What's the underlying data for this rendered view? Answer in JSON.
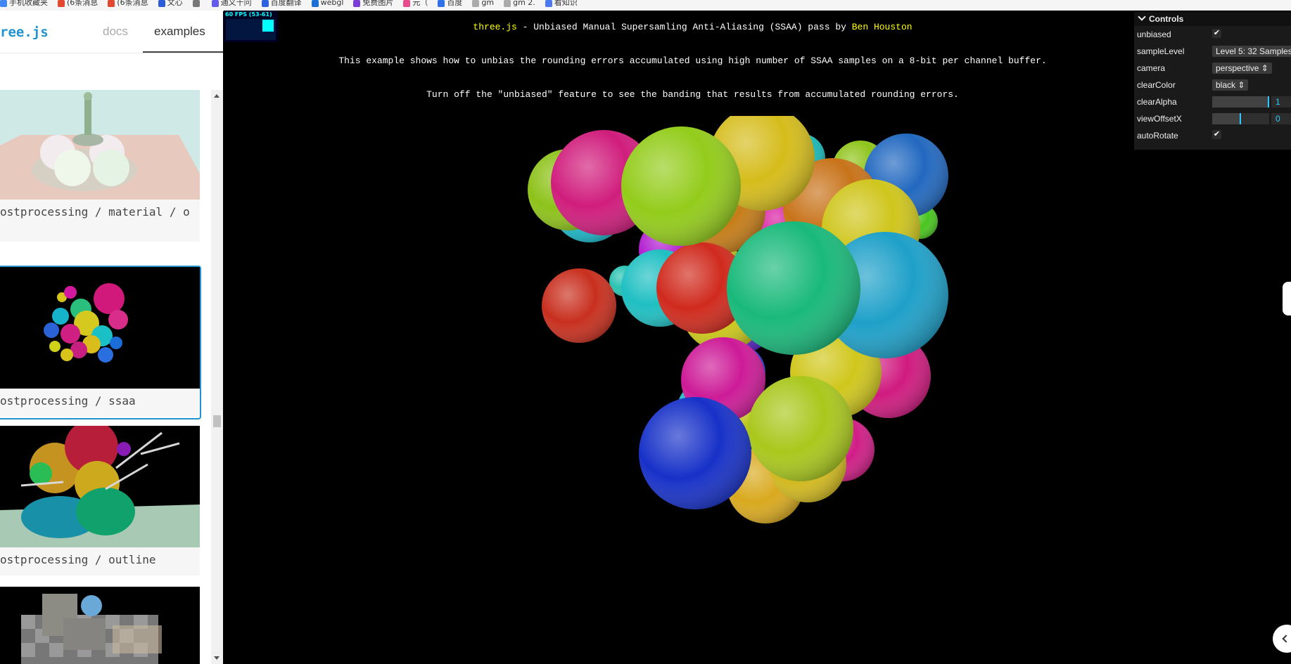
{
  "bookmarks": [
    {
      "label": "手机收藏夹",
      "color": "#4285f4"
    },
    {
      "label": "(6条消息",
      "color": "#e2472f"
    },
    {
      "label": "(6条消息",
      "color": "#e2472f"
    },
    {
      "label": "文心",
      "color": "#2b5bd7"
    },
    {
      "label": "",
      "color": "#777"
    },
    {
      "label": "通义千问",
      "color": "#615ced"
    },
    {
      "label": "百度翻译",
      "color": "#2d63e0"
    },
    {
      "label": "webgl",
      "color": "#1c6fd6"
    },
    {
      "label": "免费图片",
      "color": "#7a3ed6"
    },
    {
      "label": "元（",
      "color": "#e94b8c"
    },
    {
      "label": "百度",
      "color": "#3070e8"
    },
    {
      "label": "gm",
      "color": "#aaa"
    },
    {
      "label": "gm 2.",
      "color": "#aaa"
    },
    {
      "label": "看知识",
      "color": "#4a78f0"
    }
  ],
  "sidebar": {
    "logo": "ree.js",
    "tab_docs": "docs",
    "tab_examples": "examples",
    "cards": [
      {
        "label": "ostprocessing / material / o"
      },
      {
        "label": "ostprocessing / ssaa"
      },
      {
        "label": "ostprocessing / outline"
      },
      {
        "label": ""
      }
    ]
  },
  "stats": {
    "fps": "60 FPS (53-61)"
  },
  "info": {
    "title_link": "three.js",
    "title_text": " - Unbiased Manual Supersamling Anti-Aliasing (SSAA) pass by ",
    "author_link": "Ben Houston",
    "line1": "This example shows how to unbias the rounding errors accumulated using high number of SSAA samples on a 8-bit per channel buffer.",
    "line2": "Turn off the \"unbiased\" feature to see the banding that results from accumulated rounding errors."
  },
  "gui": {
    "title": "Controls",
    "unbiased": {
      "label": "unbiased",
      "checked": "✔"
    },
    "sampleLevel": {
      "label": "sampleLevel",
      "value": "Level 5: 32 Samples"
    },
    "camera": {
      "label": "camera",
      "value": "perspective ⇕"
    },
    "clearColor": {
      "label": "clearColor",
      "value": "black ⇕"
    },
    "clearAlpha": {
      "label": "clearAlpha",
      "value": "1",
      "fraction": 1
    },
    "viewOffsetX": {
      "label": "viewOffsetX",
      "value": "0",
      "fraction": 0.5
    },
    "autoRotate": {
      "label": "autoRotate",
      "checked": "✔"
    }
  },
  "colors": {
    "accent": "#2194ce",
    "gui_number": "#2cc9ff",
    "info_link": "#ffff00"
  }
}
